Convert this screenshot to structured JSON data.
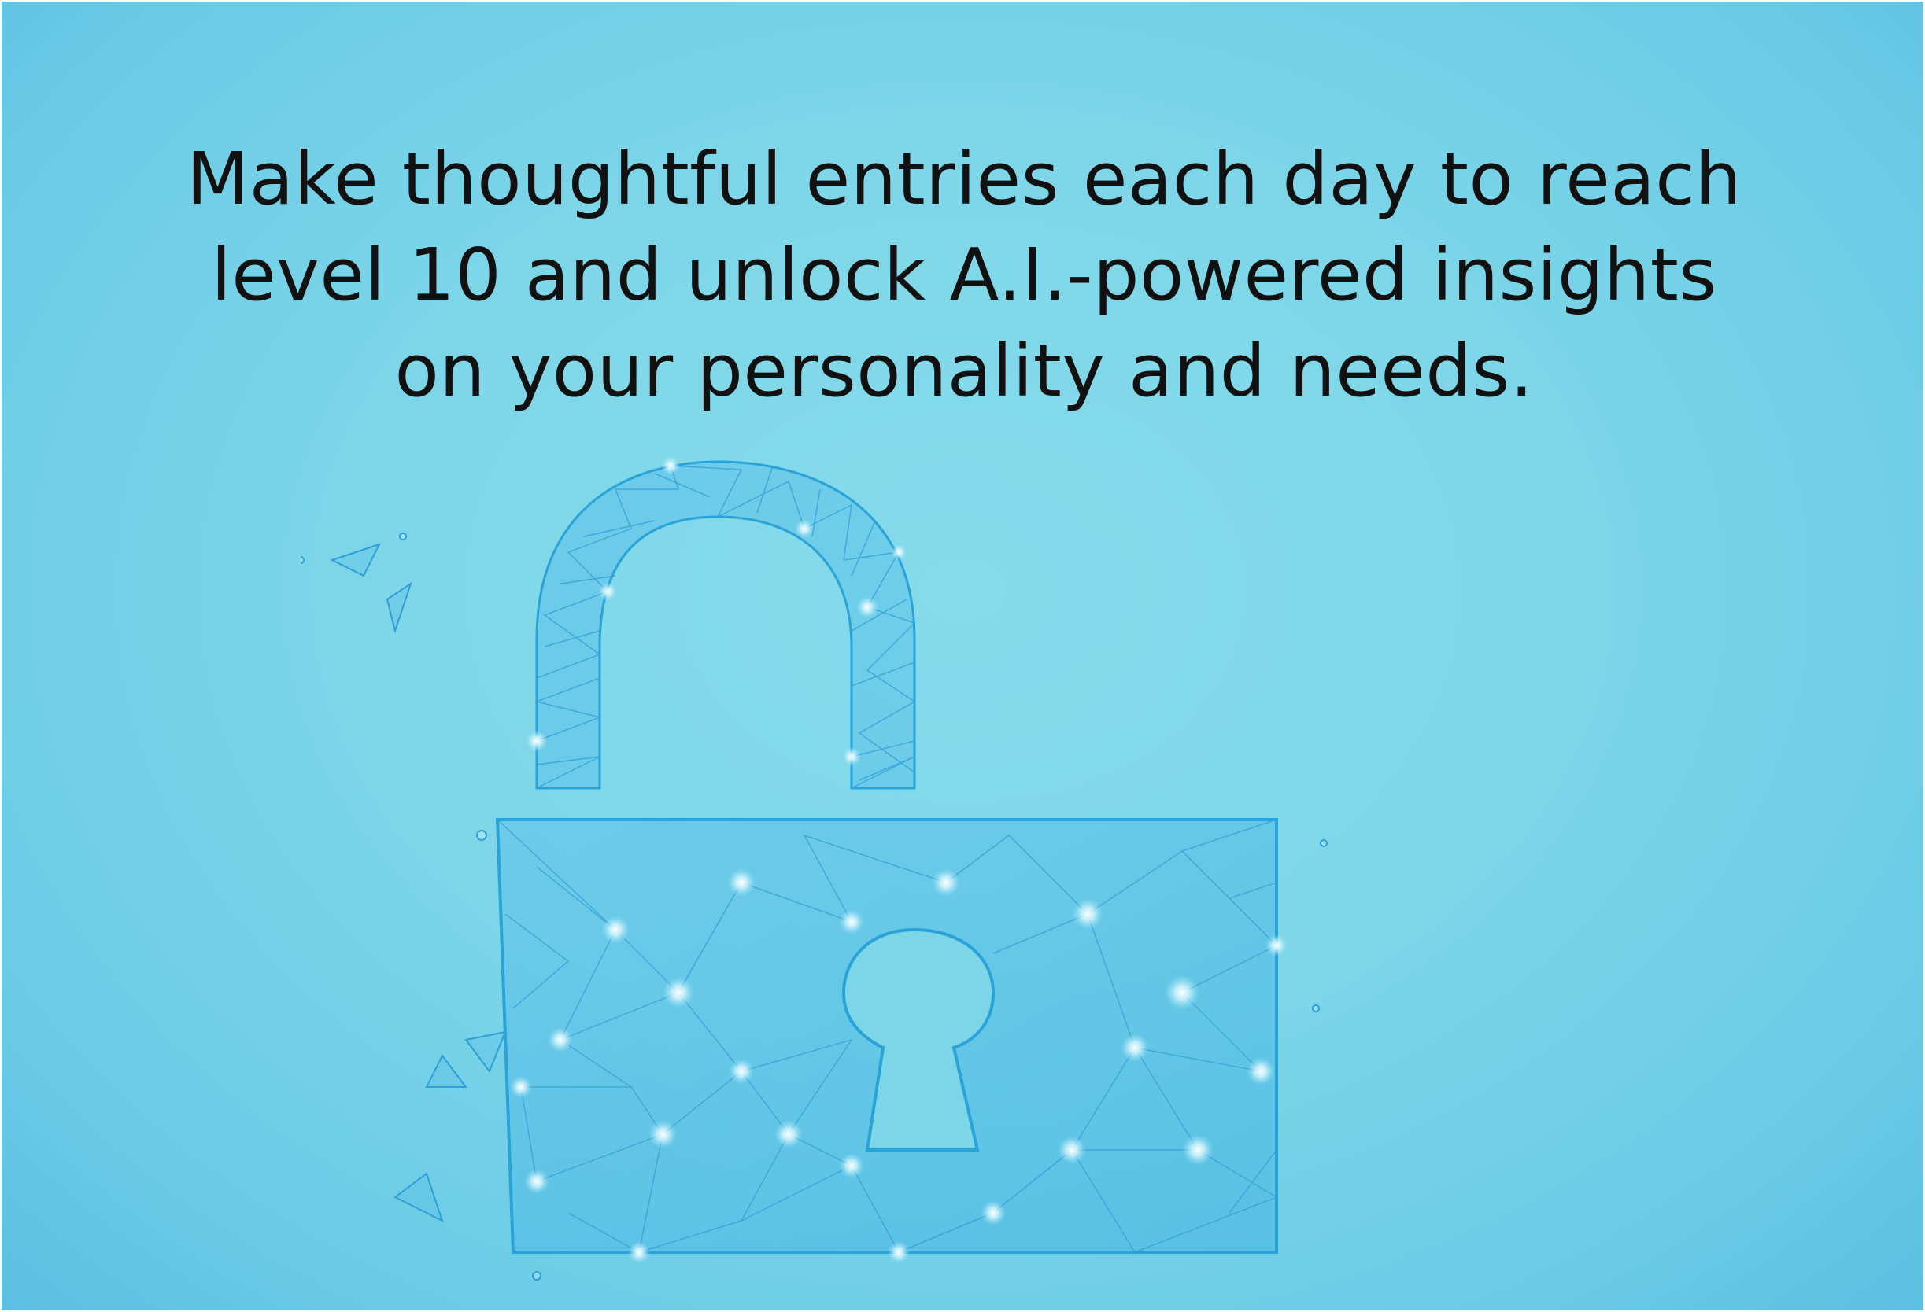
{
  "message": {
    "line1": "Make thoughtful entries each day to reach",
    "line2": "level 10 and unlock A.I.-powered insights",
    "line3": "on your personality and needs."
  },
  "illustration": {
    "icon": "unlocked-padlock-icon",
    "style": "low-poly wireframe network"
  },
  "colors": {
    "background": "#7dd6e8",
    "text": "#111111",
    "lock_line": "#2aa3d8",
    "glow": "#e8fbff"
  }
}
